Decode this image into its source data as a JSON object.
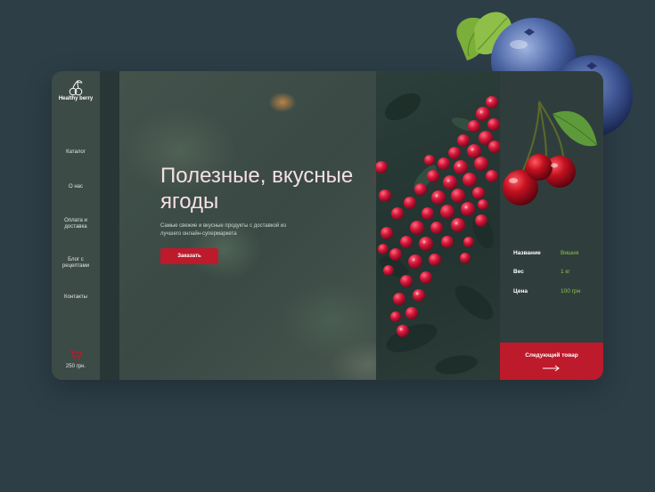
{
  "brand": {
    "name": "Healthy berry",
    "icon": "cherry-logo-icon"
  },
  "nav": {
    "items": [
      {
        "label": "Каталог"
      },
      {
        "label": "О нас"
      },
      {
        "label": "Оплата и доставка"
      },
      {
        "label": "Блог с рецептами"
      },
      {
        "label": "Контакты"
      }
    ]
  },
  "cart": {
    "icon": "cart-icon",
    "total": "250 грн."
  },
  "hero": {
    "title": "Полезные, вкусные ягоды",
    "subtitle": "Самые свежие и вкусные продукты с доставкой из лучшего онлайн-супермаркета",
    "order_label": "Заказать"
  },
  "product": {
    "name_label": "Название",
    "name_value": "Вишня",
    "weight_label": "Вес",
    "weight_value": "1 кг",
    "price_label": "Цена",
    "price_value": "100 грн"
  },
  "next": {
    "label": "Следующий товар",
    "icon": "arrow-right-icon"
  },
  "colors": {
    "page_bg": "#2d3e47",
    "accent": "#bd1a2c",
    "value_green": "#8fc348",
    "title_pink": "#f4e0e4"
  }
}
